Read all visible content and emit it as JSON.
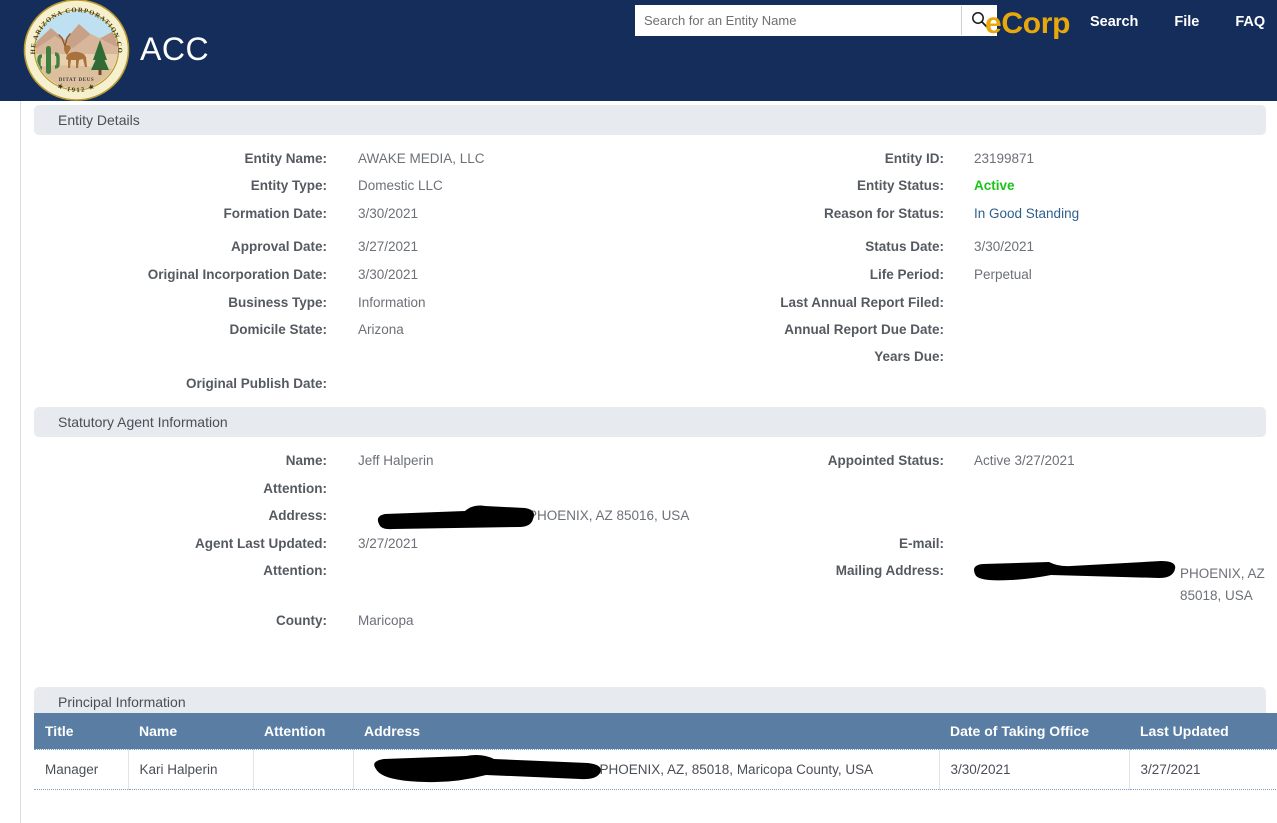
{
  "header": {
    "seal_alt": "Seal of the Arizona Corporation Commission 1912",
    "brand_primary": "ACC",
    "brand_secondary": "eCorp",
    "search": {
      "placeholder": "Search for an Entity Name",
      "value": "",
      "button_icon": "search-icon"
    },
    "nav": [
      {
        "label": "Search"
      },
      {
        "label": "File"
      },
      {
        "label": "FAQ"
      }
    ],
    "colors": {
      "bar": "#152d5b",
      "accent": "#e8a80c"
    }
  },
  "entity_details": {
    "section_title": "Entity Details",
    "left": [
      {
        "label": "Entity Name:",
        "value": "AWAKE MEDIA, LLC"
      },
      {
        "label": "Entity Type:",
        "value": "Domestic LLC"
      },
      {
        "label": "Formation Date:",
        "value": "3/30/2021"
      },
      {
        "label": "Approval Date:",
        "value": "3/27/2021"
      },
      {
        "label": "Original Incorporation Date:",
        "value": "3/30/2021"
      },
      {
        "label": "Business Type:",
        "value": "Information"
      },
      {
        "label": "Domicile State:",
        "value": "Arizona"
      },
      {
        "label": "Original Publish Date:",
        "value": ""
      }
    ],
    "right": [
      {
        "label": "Entity ID:",
        "value": "23199871"
      },
      {
        "label": "Entity Status:",
        "value": "Active"
      },
      {
        "label": "Reason for Status:",
        "value": "In Good Standing"
      },
      {
        "label": "Status Date:",
        "value": "3/30/2021"
      },
      {
        "label": "Life Period:",
        "value": "Perpetual"
      },
      {
        "label": "Last Annual Report Filed:",
        "value": ""
      },
      {
        "label": "Annual Report Due Date:",
        "value": ""
      },
      {
        "label": "Years Due:",
        "value": ""
      }
    ]
  },
  "statutory_agent": {
    "section_title": "Statutory Agent Information",
    "left": [
      {
        "label": "Name:",
        "value": "Jeff Halperin"
      },
      {
        "label": "Attention:",
        "value": ""
      },
      {
        "label": "Address:",
        "value": "PHOENIX, AZ 85016, USA",
        "redacted": true
      },
      {
        "label": "Agent Last Updated:",
        "value": "3/27/2021"
      },
      {
        "label": "Attention:",
        "value": ""
      },
      {
        "label": "County:",
        "value": "Maricopa"
      }
    ],
    "right": [
      {
        "label": "Appointed Status:",
        "value": "Active 3/27/2021"
      },
      {
        "label": "E-mail:",
        "value": ""
      },
      {
        "label": "Mailing Address:",
        "value": "PHOENIX, AZ 85018, USA",
        "redacted": true
      }
    ]
  },
  "principal_information": {
    "section_title": "Principal Information",
    "columns": [
      "Title",
      "Name",
      "Attention",
      "Address",
      "Date of Taking Office",
      "Last Updated"
    ],
    "rows": [
      {
        "title": "Manager",
        "name": "Kari Halperin",
        "attention": "",
        "address": "PHOENIX, AZ, 85018, Maricopa County, USA",
        "address_redacted": true,
        "date_of_taking_office": "3/30/2021",
        "last_updated": "3/27/2021"
      }
    ]
  }
}
